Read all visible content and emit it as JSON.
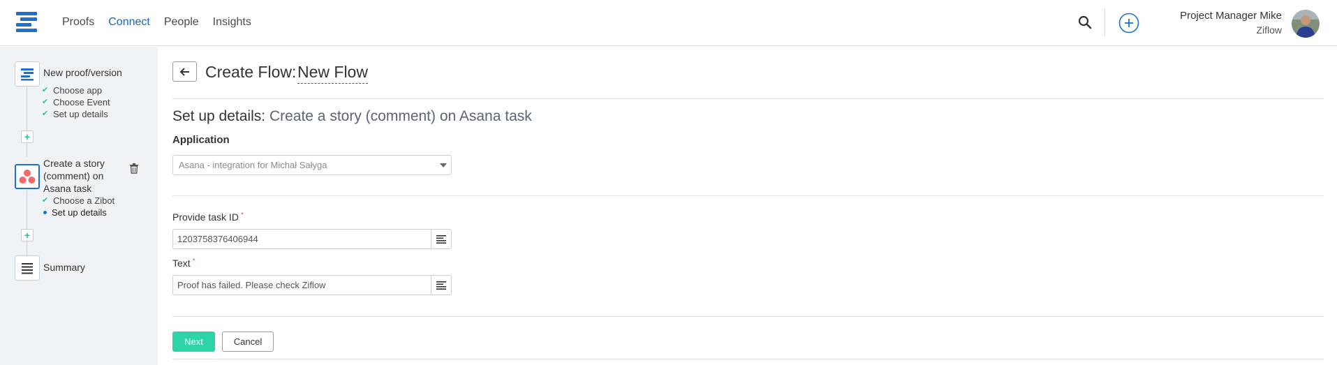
{
  "nav": {
    "items": [
      {
        "label": "Proofs",
        "active": false
      },
      {
        "label": "Connect",
        "active": true
      },
      {
        "label": "People",
        "active": false
      },
      {
        "label": "Insights",
        "active": false
      }
    ]
  },
  "user": {
    "name": "Project Manager Mike",
    "org": "Ziflow"
  },
  "sidebar": {
    "steps": [
      {
        "title": "New proof/version",
        "icon": "ziflow-logo-icon",
        "subitems": [
          {
            "label": "Choose app",
            "state": "done"
          },
          {
            "label": "Choose Event",
            "state": "done"
          },
          {
            "label": "Set up details",
            "state": "done"
          }
        ]
      },
      {
        "title_lines": [
          "Create a story",
          "(comment) on",
          "Asana task"
        ],
        "icon": "asana-icon",
        "subitems": [
          {
            "label": "Choose a Zibot",
            "state": "done"
          },
          {
            "label": "Set up details",
            "state": "current"
          }
        ]
      },
      {
        "title": "Summary",
        "icon": "summary-lines-icon"
      }
    ]
  },
  "header": {
    "title": "Create Flow:",
    "flow_name": "New Flow"
  },
  "section": {
    "title_prefix": "Set up details:",
    "title_rest": "Create a story (comment) on Asana task"
  },
  "form": {
    "application_label": "Application",
    "application_value": "Asana - integration for Michał Sałyga",
    "task_id_label": "Provide task ID",
    "task_id_value": "1203758376406944",
    "text_label": "Text",
    "text_value": "Proof has failed. Please check Ziflow",
    "required_mark": "*"
  },
  "actions": {
    "next": "Next",
    "cancel": "Cancel"
  },
  "colors": {
    "accent_blue": "#1565c0",
    "success_green": "#2ed3a8",
    "required_red": "#e0524b",
    "sidebar_bg": "#f0f3f6"
  }
}
